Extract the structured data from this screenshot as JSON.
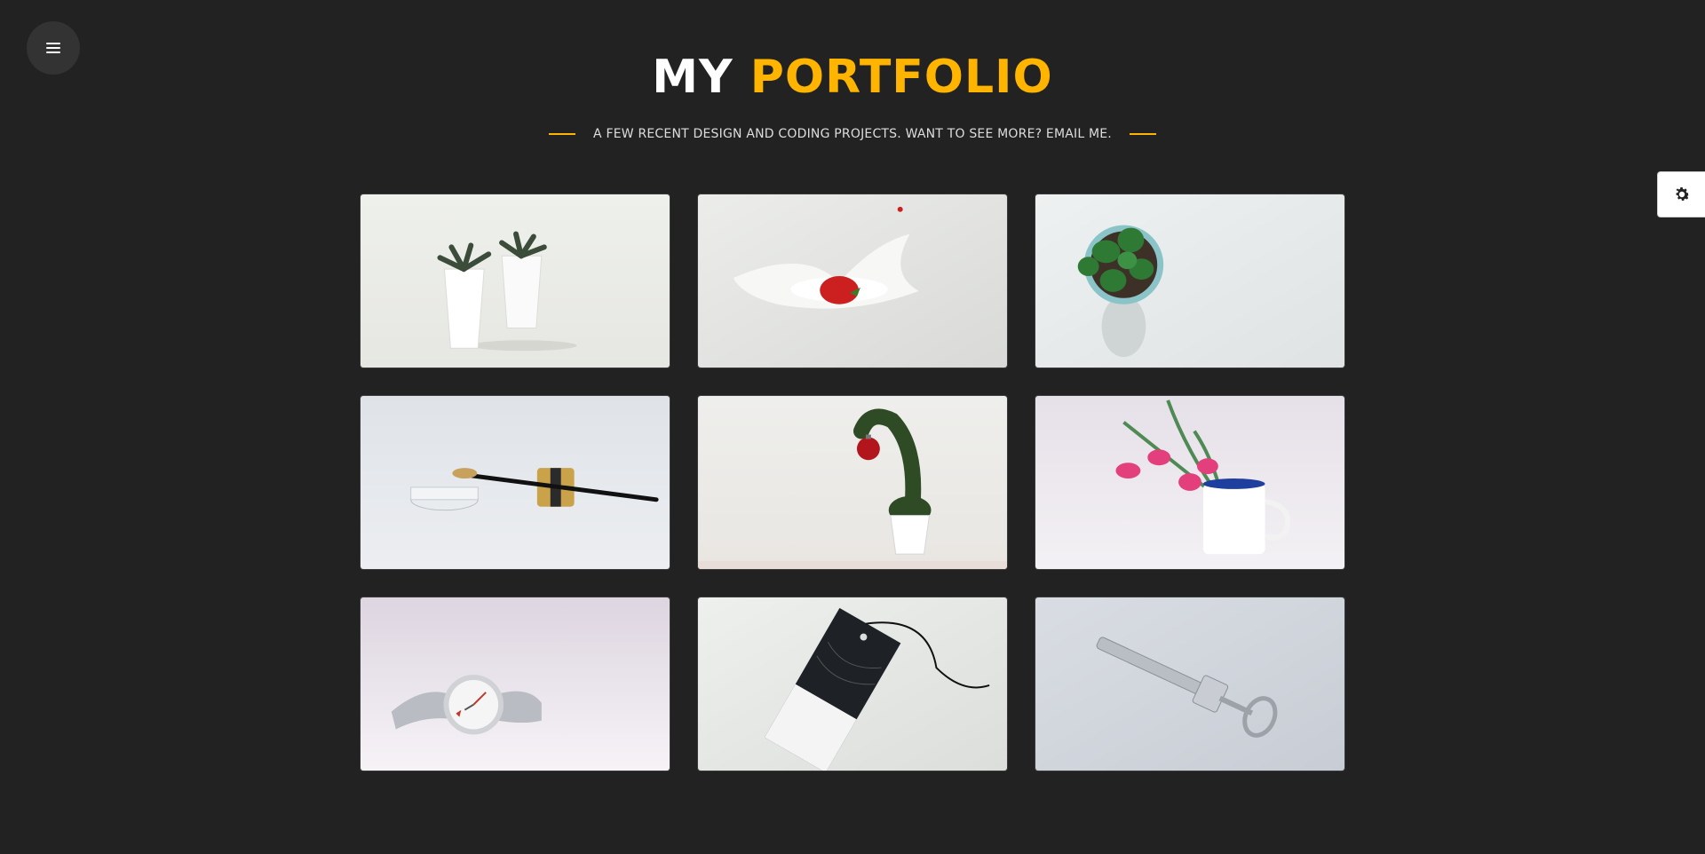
{
  "nav": {
    "menu_icon": "hamburger-icon",
    "settings_icon": "gear-icon"
  },
  "header": {
    "title_part1": "MY",
    "title_part2": "PORTFOLIO",
    "subtitle": "A FEW RECENT DESIGN AND CODING PROJECTS. WANT TO SEE MORE? EMAIL ME."
  },
  "colors": {
    "background": "#222222",
    "accent": "#ffb400",
    "text": "#ffffff"
  },
  "portfolio": {
    "items": [
      {
        "subject": "succulents-in-white-pots"
      },
      {
        "subject": "strawberry-milk-splash"
      },
      {
        "subject": "potted-plant-top-view"
      },
      {
        "subject": "makeup-brush-and-jars"
      },
      {
        "subject": "curved-topiary-with-ornament"
      },
      {
        "subject": "pink-tulips-in-mug"
      },
      {
        "subject": "silver-wristwatch"
      },
      {
        "subject": "mockup-hang-tag"
      },
      {
        "subject": "metal-syringe-tool"
      }
    ]
  }
}
